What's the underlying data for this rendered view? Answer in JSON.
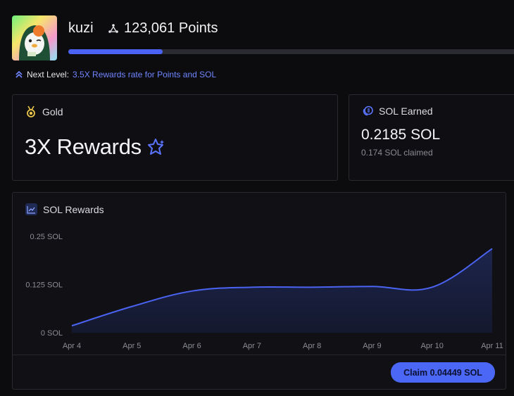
{
  "user": {
    "name": "kuzi",
    "points": "123,061 Points",
    "progress_fraction": 0.21
  },
  "next_level": {
    "label": "Next Level:",
    "value": "3.5X Rewards rate for Points and SOL"
  },
  "tier_card": {
    "tier": "Gold",
    "rewards": "3X Rewards"
  },
  "sol_card": {
    "title": "SOL Earned",
    "amount": "0.2185 SOL",
    "claimed": "0.174 SOL claimed"
  },
  "chart_card": {
    "title": "SOL Rewards",
    "claim_label": "Claim 0.04449 SOL"
  },
  "colors": {
    "accent": "#4b63f5",
    "gold": "#e9c54a",
    "line": "#4a63f2"
  },
  "icons": {
    "points": "triangle-dots-icon",
    "next_level": "double-chevron-up-icon",
    "tier": "medal-icon",
    "rewards": "star-sparkle-icon",
    "sol": "coin-stack-icon",
    "chart": "line-chart-icon"
  },
  "chart_data": {
    "type": "area",
    "title": "SOL Rewards",
    "x": [
      "Apr 4",
      "Apr 5",
      "Apr 6",
      "Apr 7",
      "Apr 8",
      "Apr 9",
      "Apr 10",
      "Apr 11"
    ],
    "yticks": [
      "0 SOL",
      "0.125 SOL",
      "0.25 SOL"
    ],
    "ytick_values": [
      0,
      0.125,
      0.25
    ],
    "ylim": [
      0,
      0.25
    ],
    "series": [
      {
        "values": [
          0.018,
          0.068,
          0.108,
          0.118,
          0.118,
          0.12,
          0.118,
          0.218
        ]
      }
    ],
    "grid": false,
    "legend": "none"
  }
}
